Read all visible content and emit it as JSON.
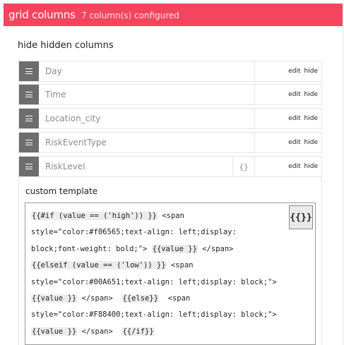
{
  "header": {
    "title": "grid columns",
    "subtitle": "7 column(s) configured"
  },
  "hide_hidden_label": "hide hidden columns",
  "columns": [
    {
      "name": "Day",
      "edit": "edit",
      "hide": "hide"
    },
    {
      "name": "Time",
      "edit": "edit",
      "hide": "hide"
    },
    {
      "name": "Location_city",
      "edit": "edit",
      "hide": "hide"
    },
    {
      "name": "RiskEventType",
      "edit": "edit",
      "hide": "hide"
    },
    {
      "name": "RiskLevel",
      "edit": "edit",
      "hide": "hide",
      "braces": "{}"
    }
  ],
  "template": {
    "label": "custom template",
    "button": "{{}}",
    "lines": [
      [
        "{{#if (value == ('high')) }}",
        " <span"
      ],
      [
        "style=\"color:#f06565;text-align: left;display:"
      ],
      [
        "block;font-weight: bold;\"> ",
        "{{value }}",
        " </span>"
      ],
      [
        "{{elseif (value == ('low')) }}",
        " <span"
      ],
      [
        "style=\"color:#00A651;text-align: left;display: block;\">"
      ],
      [
        "{{value }}",
        " </span>  ",
        "{{else}}",
        "  <span"
      ],
      [
        "style=\"color:#F88400;text-align: left;display: block;\">"
      ],
      [
        "{{value }}",
        " </span>  ",
        "{{/if}}"
      ]
    ]
  }
}
